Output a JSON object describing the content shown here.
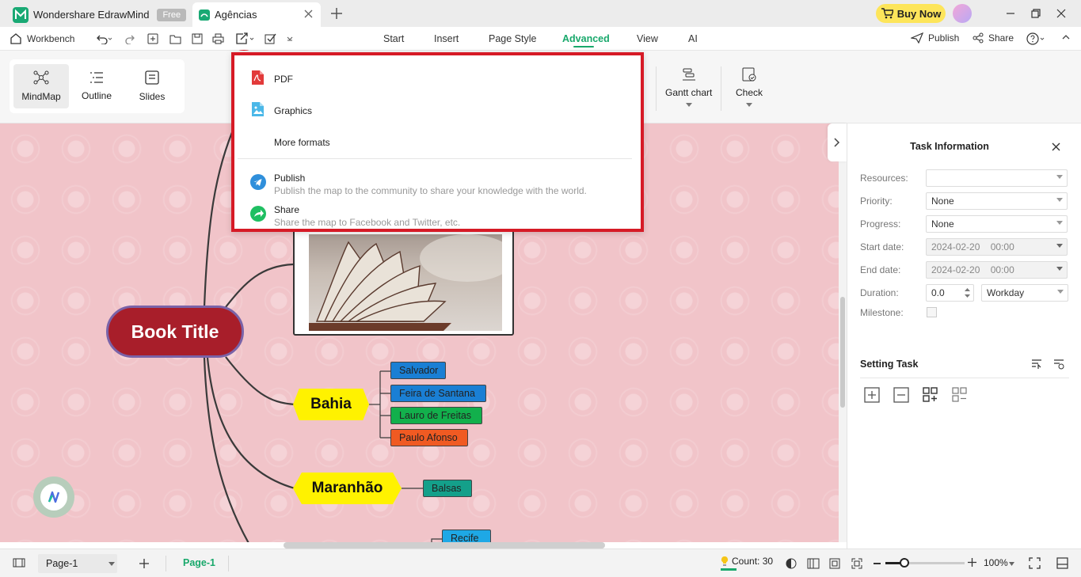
{
  "titlebar": {
    "app_name": "Wondershare EdrawMind",
    "plan_badge": "Free",
    "doc_tab": "Agências",
    "buy_now": "Buy Now"
  },
  "toolbar": {
    "workbench": "Workbench",
    "menu": [
      "Start",
      "Insert",
      "Page Style",
      "Advanced",
      "View",
      "AI"
    ],
    "active_menu": "Advanced",
    "publish": "Publish",
    "share": "Share"
  },
  "ribbon": {
    "modes": [
      "MindMap",
      "Outline",
      "Slides"
    ],
    "gantt": "Gantt chart",
    "check": "Check"
  },
  "export_menu": {
    "pdf": "PDF",
    "graphics": "Graphics",
    "more_formats": "More formats",
    "publish_title": "Publish",
    "publish_desc": "Publish the map to the community to share your knowledge with the world.",
    "share_title": "Share",
    "share_desc": "Share the map to Facebook and Twitter, etc."
  },
  "mindmap": {
    "root": "Book Title",
    "bahia": "Bahia",
    "bahia_children": [
      "Salvador",
      "Feira de Santana",
      "Lauro de Freitas",
      "Paulo Afonso"
    ],
    "maranhao": "Maranhão",
    "maranhao_children": [
      "Balsas"
    ],
    "next_child": "Recife",
    "colors": {
      "root_fill": "#a81e2a",
      "root_border": "#7a63a8",
      "hex_fill": "#fff200",
      "leaf_blue": "#1a7fd4",
      "leaf_green": "#12b04c",
      "leaf_orange": "#f05a22",
      "leaf_teal": "#14a08a",
      "leaf_sky": "#1ea8e6",
      "canvas": "#f1c4c9"
    }
  },
  "panel": {
    "title": "Task Information",
    "resources_label": "Resources:",
    "resources_value": "",
    "priority_label": "Priority:",
    "priority_value": "None",
    "progress_label": "Progress:",
    "progress_value": "None",
    "start_label": "Start date:",
    "start_value": "2024-02-20    00:00",
    "end_label": "End date:",
    "end_value": "2024-02-20    00:00",
    "duration_label": "Duration:",
    "duration_value": "0.0",
    "duration_unit": "Workday",
    "milestone_label": "Milestone:",
    "setting_title": "Setting Task"
  },
  "statusbar": {
    "page_select": "Page-1",
    "page_tab": "Page-1",
    "count": "Count: 30",
    "zoom": "100%"
  }
}
